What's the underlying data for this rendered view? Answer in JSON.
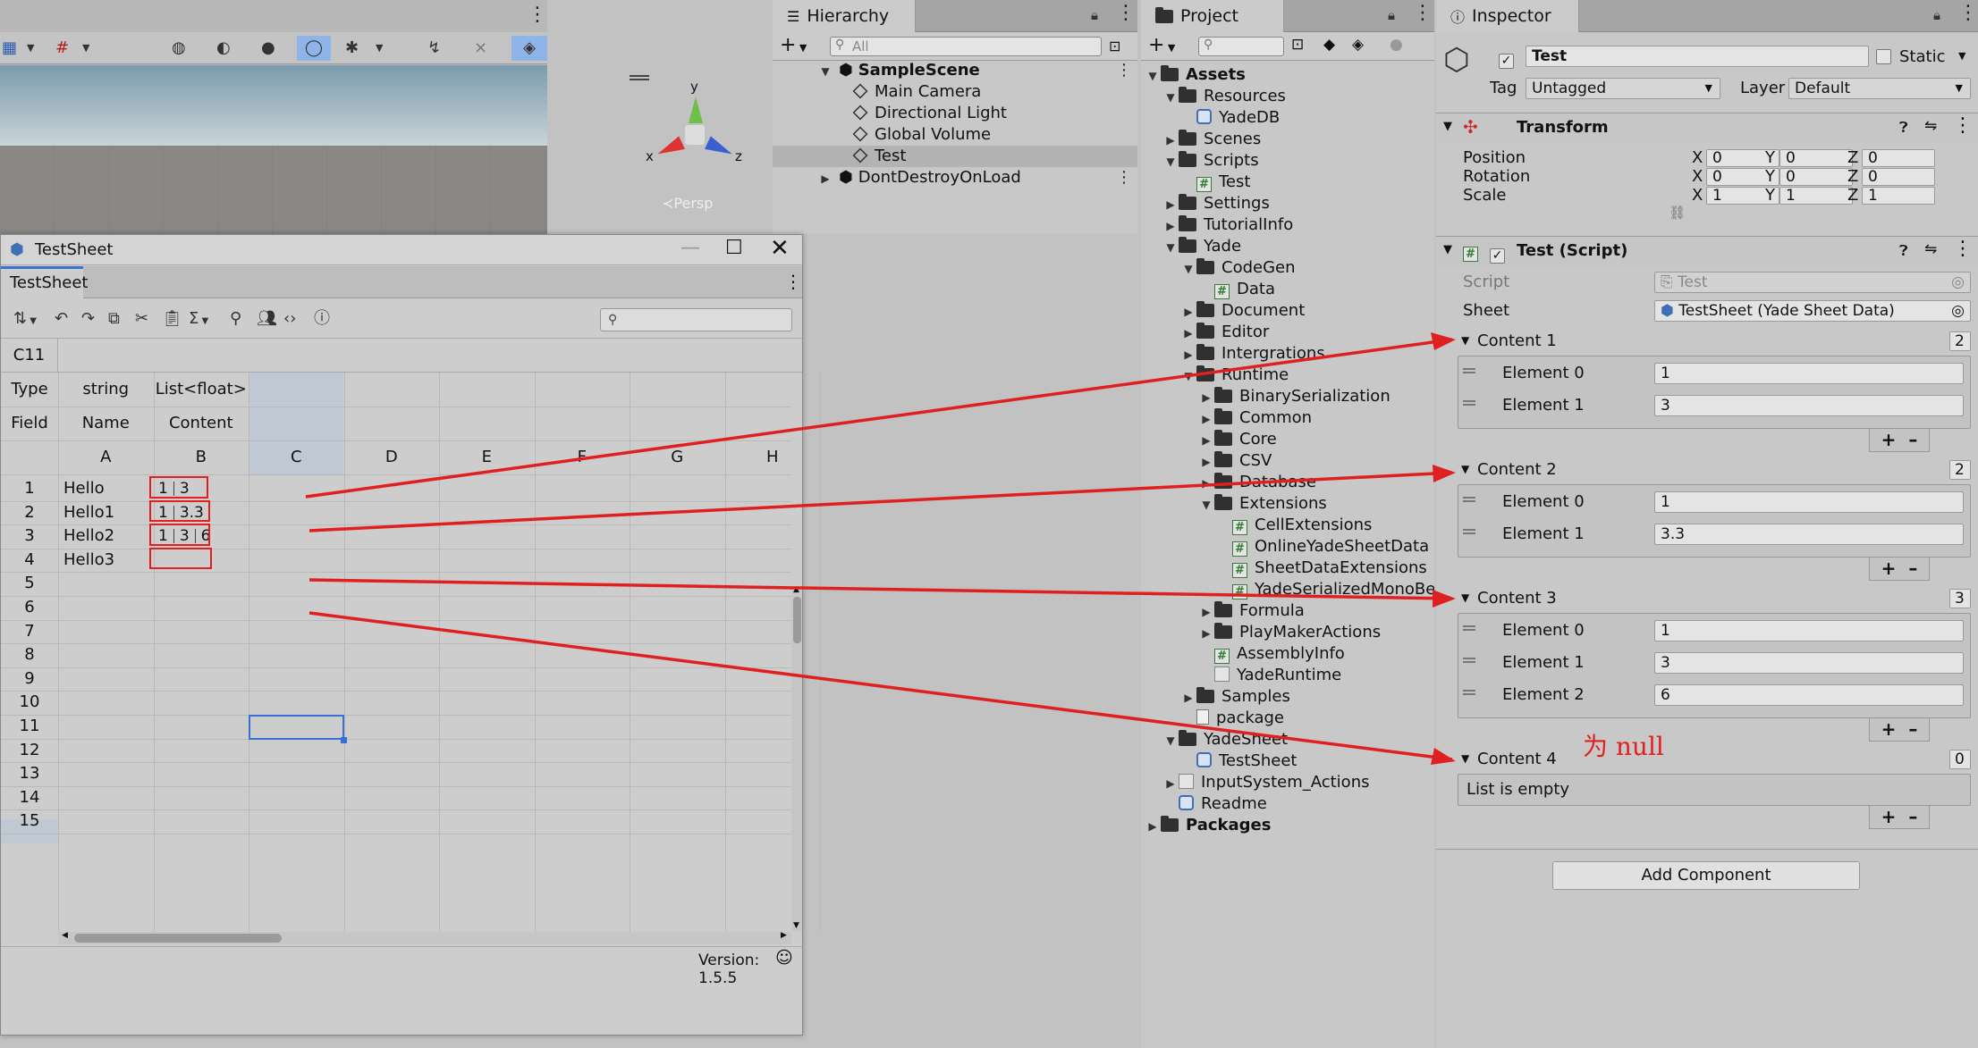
{
  "scene_view": {
    "persp_label": "≺Persp",
    "gizmo_y": "y",
    "gizmo_x": "x",
    "gizmo_z": "z"
  },
  "hierarchy": {
    "tab": "Hierarchy",
    "search_placeholder": "All",
    "items": [
      {
        "label": "SampleScene"
      },
      {
        "label": "Main Camera"
      },
      {
        "label": "Directional Light"
      },
      {
        "label": "Global Volume"
      },
      {
        "label": "Test"
      },
      {
        "label": "DontDestroyOnLoad"
      }
    ]
  },
  "project": {
    "tab": "Project",
    "items": [
      {
        "label": "Assets"
      },
      {
        "label": "Resources"
      },
      {
        "label": "YadeDB"
      },
      {
        "label": "Scenes"
      },
      {
        "label": "Scripts"
      },
      {
        "label": "Test"
      },
      {
        "label": "Settings"
      },
      {
        "label": "TutorialInfo"
      },
      {
        "label": "Yade"
      },
      {
        "label": "CodeGen"
      },
      {
        "label": "Data"
      },
      {
        "label": "Document"
      },
      {
        "label": "Editor"
      },
      {
        "label": "Intergrations"
      },
      {
        "label": "Runtime"
      },
      {
        "label": "BinarySerialization"
      },
      {
        "label": "Common"
      },
      {
        "label": "Core"
      },
      {
        "label": "CSV"
      },
      {
        "label": "Database"
      },
      {
        "label": "Extensions"
      },
      {
        "label": "CellExtensions"
      },
      {
        "label": "OnlineYadeSheetData"
      },
      {
        "label": "SheetDataExtensions"
      },
      {
        "label": "YadeSerializedMonoBe"
      },
      {
        "label": "Formula"
      },
      {
        "label": "PlayMakerActions"
      },
      {
        "label": "AssemblyInfo"
      },
      {
        "label": "YadeRuntime"
      },
      {
        "label": "Samples"
      },
      {
        "label": "package"
      },
      {
        "label": "YadeSheet"
      },
      {
        "label": "TestSheet"
      },
      {
        "label": "InputSystem_Actions"
      },
      {
        "label": "Readme"
      },
      {
        "label": "Packages"
      }
    ]
  },
  "sheet": {
    "window_title": "TestSheet",
    "tab": "TestSheet",
    "cell_ref": "C11",
    "type_label": "Type",
    "field_label": "Field",
    "type_row": [
      "string",
      "List<float>"
    ],
    "field_row": [
      "Name",
      "Content"
    ],
    "columns": [
      "A",
      "B",
      "C",
      "D",
      "E",
      "F",
      "G",
      "H"
    ],
    "rows": [
      "1",
      "2",
      "3",
      "4",
      "5",
      "6",
      "7",
      "8",
      "9",
      "10",
      "11",
      "12",
      "13",
      "14",
      "15"
    ],
    "data": [
      {
        "name": "Hello",
        "content": [
          "1",
          "3"
        ]
      },
      {
        "name": "Hello1",
        "content": [
          "1",
          "3.3"
        ]
      },
      {
        "name": "Hello2",
        "content": [
          "1",
          "3",
          "6"
        ]
      },
      {
        "name": "Hello3",
        "content": []
      }
    ],
    "version": "Version: 1.5.5"
  },
  "inspector": {
    "tab": "Inspector",
    "object_name": "Test",
    "static_label": "Static",
    "tag_label": "Tag",
    "tag_value": "Untagged",
    "layer_label": "Layer",
    "layer_value": "Default",
    "transform": {
      "title": "Transform",
      "rows": [
        {
          "label": "Position",
          "x": "0",
          "y": "0",
          "z": "0"
        },
        {
          "label": "Rotation",
          "x": "0",
          "y": "0",
          "z": "0"
        },
        {
          "label": "Scale",
          "x": "1",
          "y": "1",
          "z": "1"
        }
      ],
      "axis": [
        "X",
        "Y",
        "Z"
      ]
    },
    "script_component": {
      "title": "Test (Script)",
      "script_label": "Script",
      "script_value": "Test",
      "sheet_label": "Sheet",
      "sheet_value": "TestSheet (Yade Sheet Data)"
    },
    "lists": [
      {
        "label": "Content 1",
        "count": "2",
        "elements": [
          {
            "label": "Element 0",
            "value": "1"
          },
          {
            "label": "Element 1",
            "value": "3"
          }
        ]
      },
      {
        "label": "Content 2",
        "count": "2",
        "elements": [
          {
            "label": "Element 0",
            "value": "1"
          },
          {
            "label": "Element 1",
            "value": "3.3"
          }
        ]
      },
      {
        "label": "Content 3",
        "count": "3",
        "elements": [
          {
            "label": "Element 0",
            "value": "1"
          },
          {
            "label": "Element 1",
            "value": "3"
          },
          {
            "label": "Element 2",
            "value": "6"
          }
        ]
      },
      {
        "label": "Content 4",
        "count": "0",
        "empty_text": "List is empty"
      }
    ],
    "null_note": "为 null",
    "add_component": "Add Component"
  },
  "colors": {
    "annotation_red": "#e02020",
    "selection_blue": "#3a6fd6"
  }
}
